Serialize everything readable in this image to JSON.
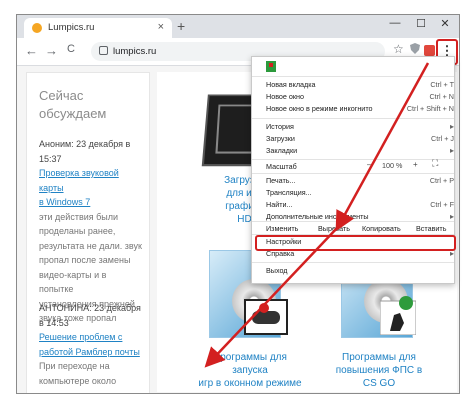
{
  "tab": {
    "title": "Lumpics.ru",
    "close": "×",
    "new": "+"
  },
  "window": {
    "minimize": "—",
    "maximize": "☐",
    "close": "✕"
  },
  "nav": {
    "back": "←",
    "forward": "→",
    "reload": "C"
  },
  "address": {
    "url": "lumpics.ru"
  },
  "toolbar": {
    "star": "☆",
    "menu": "⋮"
  },
  "sidebar": {
    "title_line1": "Сейчас",
    "title_line2": "обсуждаем",
    "c1_name": "Аноним: 23 декабря в",
    "c1_time": "15:37",
    "c1_link_1": "Проверка звуковой карты",
    "c1_link_2": "в Windows 7",
    "c1_text": [
      "эти действия были",
      "проделаны ранее,",
      "результата не дали. звук",
      "пропал после замены",
      "видео-карты и в попытке",
      "установления прежней",
      "звука тоже пропал"
    ],
    "c2_name": "АНТОНИНА: 23 декабря",
    "c2_time": "в 14:53",
    "c2_link_1": "Решение проблем с",
    "c2_link_2": "работой Рамблер почты",
    "c2_text": [
      "При переходе на",
      "компьютере около месяца"
    ]
  },
  "articles": {
    "a1": [
      "Загрузка драй",
      "для интегрир",
      "графики AMD",
      "HD 8650"
    ],
    "a2": [
      "Программы для запуска",
      "игр в оконном режиме"
    ],
    "a3": [
      "Программы для",
      "повышения ФПС в",
      "CS GO"
    ]
  },
  "menu": {
    "new_tab": "Новая вкладка",
    "new_tab_sc": "Ctrl + T",
    "new_window": "Новое окно",
    "new_window_sc": "Ctrl + N",
    "incognito": "Новое окно в режиме инкогнито",
    "incognito_sc": "Ctrl + Shift + N",
    "history": "История",
    "downloads": "Загрузки",
    "downloads_sc": "Ctrl + J",
    "bookmarks": "Закладки",
    "zoom": "Масштаб",
    "zoom_minus": "–",
    "zoom_value": "100 %",
    "zoom_plus": "+",
    "print": "Печать...",
    "print_sc": "Ctrl + P",
    "cast": "Трансляция...",
    "find": "Найти...",
    "find_sc": "Ctrl + F",
    "more_tools": "Дополнительные инструменты",
    "edit": "Изменить",
    "cut": "Вырезать",
    "copy": "Копировать",
    "paste": "Вставить",
    "settings": "Настройки",
    "help": "Справка",
    "exit": "Выход"
  },
  "colors": {
    "accent_red": "#d32020",
    "link": "#1f82c4"
  }
}
